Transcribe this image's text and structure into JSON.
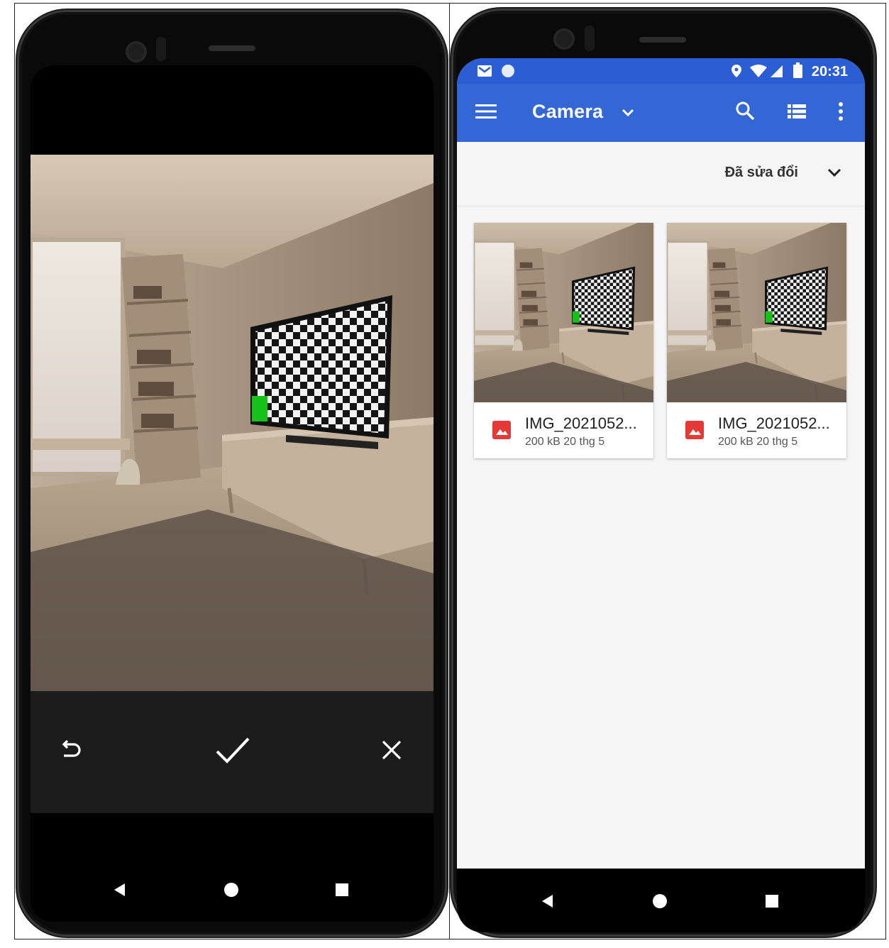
{
  "left_phone": {
    "preview_controls": {
      "retake_icon": "undo-icon",
      "confirm_icon": "check-icon",
      "cancel_icon": "close-icon"
    },
    "nav": {
      "back_icon": "back-triangle-icon",
      "home_icon": "home-circle-icon",
      "recents_icon": "recents-square-icon"
    }
  },
  "right_phone": {
    "status_bar": {
      "time": "20:31",
      "left_icons": [
        "gmail-icon",
        "sync-circle-icon"
      ],
      "right_icons": [
        "location-icon",
        "wifi-icon",
        "signal-icon",
        "battery-icon"
      ]
    },
    "app_bar": {
      "title": "Camera",
      "menu_icon": "hamburger-menu-icon",
      "dropdown_icon": "chevron-down-icon",
      "search_icon": "search-icon",
      "view_icon": "list-view-icon",
      "more_icon": "more-vert-icon"
    },
    "sort": {
      "label": "Đã sửa đổi",
      "icon": "chevron-down-icon"
    },
    "files": [
      {
        "name": "IMG_2021052...",
        "size": "200 kB",
        "date": "20 thg 5",
        "meta": "200 kB 20 thg 5"
      },
      {
        "name": "IMG_2021052...",
        "size": "200 kB",
        "date": "20 thg 5",
        "meta": "200 kB 20 thg 5"
      }
    ],
    "nav": {
      "back_icon": "back-triangle-icon",
      "home_icon": "home-circle-icon",
      "recents_icon": "recents-square-icon"
    }
  },
  "colors": {
    "app_bar": "#3367d6",
    "status_bar": "#2b5ed4",
    "file_icon": "#e53935",
    "marker": "#15c215"
  }
}
